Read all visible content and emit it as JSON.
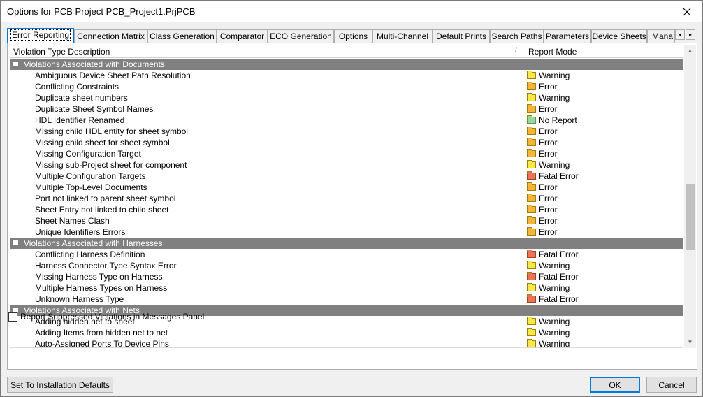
{
  "window": {
    "title": "Options for PCB Project PCB_Project1.PrjPCB"
  },
  "colors": {
    "warning": "#f7e84a",
    "error": "#f5b43a",
    "fatal": "#e8745a",
    "no_report": "#9fd59f",
    "group_bg": "#808080",
    "accent": "#0078d7"
  },
  "tabs": [
    {
      "label": "Error Reporting",
      "active": true
    },
    {
      "label": "Connection Matrix"
    },
    {
      "label": "Class Generation"
    },
    {
      "label": "Comparator"
    },
    {
      "label": "ECO Generation"
    },
    {
      "label": "Options"
    },
    {
      "label": "Multi-Channel"
    },
    {
      "label": "Default Prints"
    },
    {
      "label": "Search Paths"
    },
    {
      "label": "Parameters"
    },
    {
      "label": "Device Sheets"
    },
    {
      "label": "Mana"
    }
  ],
  "tab_scroll": {
    "left_icon": "◂",
    "right_icon": "▸"
  },
  "grid": {
    "col_description": "Violation Type Description",
    "col_sort_indicator": "/",
    "col_mode": "Report Mode",
    "rows": [
      {
        "type": "group",
        "label": "Violations Associated with Documents"
      },
      {
        "type": "item",
        "label": "Ambiguous Device Sheet Path Resolution",
        "mode": "Warning",
        "level": "warning"
      },
      {
        "type": "item",
        "label": "Conflicting Constraints",
        "mode": "Error",
        "level": "error"
      },
      {
        "type": "item",
        "label": "Duplicate sheet numbers",
        "mode": "Warning",
        "level": "warning"
      },
      {
        "type": "item",
        "label": "Duplicate Sheet Symbol Names",
        "mode": "Error",
        "level": "error"
      },
      {
        "type": "item",
        "label": "HDL Identifier Renamed",
        "mode": "No Report",
        "level": "no_report"
      },
      {
        "type": "item",
        "label": "Missing child HDL entity for sheet symbol",
        "mode": "Error",
        "level": "error"
      },
      {
        "type": "item",
        "label": "Missing child sheet for sheet symbol",
        "mode": "Error",
        "level": "error"
      },
      {
        "type": "item",
        "label": "Missing Configuration Target",
        "mode": "Error",
        "level": "error"
      },
      {
        "type": "item",
        "label": "Missing sub-Project sheet for component",
        "mode": "Warning",
        "level": "warning"
      },
      {
        "type": "item",
        "label": "Multiple Configuration Targets",
        "mode": "Fatal Error",
        "level": "fatal"
      },
      {
        "type": "item",
        "label": "Multiple Top-Level Documents",
        "mode": "Error",
        "level": "error"
      },
      {
        "type": "item",
        "label": "Port not linked to parent sheet symbol",
        "mode": "Error",
        "level": "error"
      },
      {
        "type": "item",
        "label": "Sheet Entry not linked to child sheet",
        "mode": "Error",
        "level": "error"
      },
      {
        "type": "item",
        "label": "Sheet Names Clash",
        "mode": "Error",
        "level": "error"
      },
      {
        "type": "item",
        "label": "Unique Identifiers Errors",
        "mode": "Error",
        "level": "error"
      },
      {
        "type": "group",
        "label": "Violations Associated with Harnesses"
      },
      {
        "type": "item",
        "label": "Conflicting Harness Definition",
        "mode": "Fatal Error",
        "level": "fatal"
      },
      {
        "type": "item",
        "label": "Harness Connector Type Syntax Error",
        "mode": "Warning",
        "level": "warning"
      },
      {
        "type": "item",
        "label": "Missing Harness Type on Harness",
        "mode": "Fatal Error",
        "level": "fatal"
      },
      {
        "type": "item",
        "label": "Multiple Harness Types on Harness",
        "mode": "Warning",
        "level": "warning"
      },
      {
        "type": "item",
        "label": "Unknown Harness Type",
        "mode": "Fatal Error",
        "level": "fatal"
      },
      {
        "type": "group",
        "label": "Violations Associated with Nets"
      },
      {
        "type": "item",
        "label": "Adding hidden net to sheet",
        "mode": "Warning",
        "level": "warning"
      },
      {
        "type": "item",
        "label": "Adding Items from hidden net to net",
        "mode": "Warning",
        "level": "warning"
      },
      {
        "type": "item",
        "label": "Auto-Assigned Ports To Device Pins",
        "mode": "Warning",
        "level": "warning"
      }
    ]
  },
  "scrollbar": {
    "up_icon": "▲",
    "down_icon": "▼"
  },
  "checkbox": {
    "label": "Report Suppressed Violations in Messages Panel",
    "checked": false
  },
  "buttons": {
    "defaults": "Set To Installation Defaults",
    "ok": "OK",
    "cancel": "Cancel"
  }
}
